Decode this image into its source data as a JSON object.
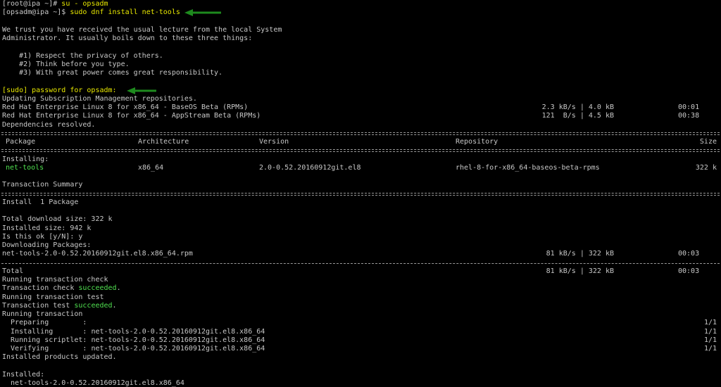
{
  "session": {
    "line1_prompt": "[root@ipa ~]#",
    "line1_cmd": " su - opsadm",
    "line2_prompt": "[opsadm@ipa ~]$",
    "line2_cmd": " sudo dnf install net-tools"
  },
  "lecture": {
    "l1": "We trust you have received the usual lecture from the local System",
    "l2": "Administrator. It usually boils down to these three things:",
    "r1": "    #1) Respect the privacy of others.",
    "r2": "    #2) Think before you type.",
    "r3": "    #3) With great power comes great responsibility."
  },
  "sudo": {
    "password_prompt": "[sudo] password for opsadm:"
  },
  "repos": {
    "updating": "Updating Subscription Management repositories.",
    "items": [
      {
        "name": "Red Hat Enterprise Linux 8 for x86_64 - BaseOS Beta (RPMs)",
        "rate": "2.3 kB/s",
        "size": "4.0 kB",
        "time": "00:01"
      },
      {
        "name": "Red Hat Enterprise Linux 8 for x86_64 - AppStream Beta (RPMs)",
        "rate": "121  B/s",
        "size": "4.5 kB",
        "time": "00:38"
      }
    ],
    "resolved": "Dependencies resolved."
  },
  "table": {
    "headers": {
      "package": "Package",
      "arch": "Architecture",
      "version": "Version",
      "repository": "Repository",
      "size": "Size"
    },
    "installing_label": "Installing:",
    "row": {
      "package": "net-tools",
      "arch": "x86_64",
      "version": "2.0-0.52.20160912git.el8",
      "repository": "rhel-8-for-x86_64-baseos-beta-rpms",
      "size": "322 k"
    }
  },
  "summary": {
    "title": "Transaction Summary",
    "install": "Install  1 Package",
    "download_size": "Total download size: 322 k",
    "installed_size": "Installed size: 942 k",
    "confirm": "Is this ok [y/N]: y",
    "downloading": "Downloading Packages:",
    "rpm": {
      "name": "net-tools-2.0-0.52.20160912git.el8.x86_64.rpm",
      "rate": "81 kB/s",
      "size": "322 kB",
      "time": "00:03"
    },
    "total": {
      "name": "Total",
      "rate": "81 kB/s",
      "size": "322 kB",
      "time": "00:03"
    }
  },
  "transaction": {
    "running_check": "Running transaction check",
    "check_prefix": "Transaction check ",
    "check_status": "succeeded",
    "running_test": "Running transaction test",
    "test_prefix": "Transaction test ",
    "test_status": "succeeded",
    "running": "Running transaction",
    "steps": [
      {
        "label": "  Preparing        :",
        "pkg": "",
        "count": "1/1"
      },
      {
        "label": "  Installing       :",
        "pkg": " net-tools-2.0-0.52.20160912git.el8.x86_64",
        "count": "1/1"
      },
      {
        "label": "  Running scriptlet:",
        "pkg": " net-tools-2.0-0.52.20160912git.el8.x86_64",
        "count": "1/1"
      },
      {
        "label": "  Verifying        :",
        "pkg": " net-tools-2.0-0.52.20160912git.el8.x86_64",
        "count": "1/1"
      }
    ],
    "products_updated": "Installed products updated.",
    "installed_label": "Installed:",
    "installed_pkg": "  net-tools-2.0-0.52.20160912git.el8.x86_64"
  },
  "colors": {
    "background": "#000000",
    "text": "#c8c8c8",
    "highlight": "#e8e800",
    "success": "#4fe04f",
    "arrow": "#1e8a1e"
  }
}
